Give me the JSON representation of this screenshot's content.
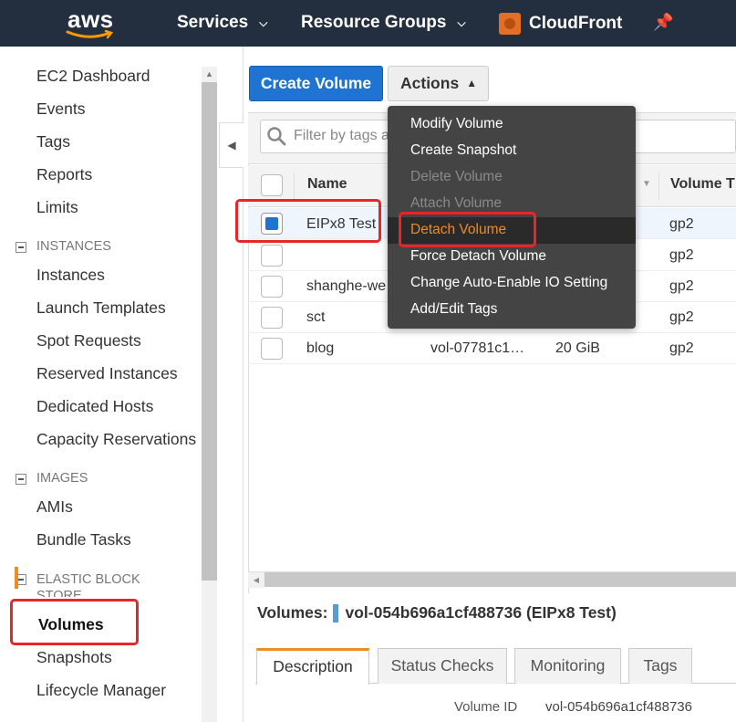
{
  "topnav": {
    "logo": "aws",
    "services": "Services",
    "resource_groups": "Resource Groups",
    "cloudfront": "CloudFront",
    "pin_icon": "pin-icon"
  },
  "sidebar": {
    "links_top": [
      "EC2 Dashboard",
      "Events",
      "Tags",
      "Reports",
      "Limits"
    ],
    "instances_header": "INSTANCES",
    "instances_links": [
      "Instances",
      "Launch Templates",
      "Spot Requests",
      "Reserved Instances",
      "Dedicated Hosts",
      "Capacity Reservations"
    ],
    "images_header": "IMAGES",
    "images_links": [
      "AMIs",
      "Bundle Tasks"
    ],
    "ebs_header_1": "ELASTIC BLOCK",
    "ebs_header_2": "STORE",
    "ebs_links": [
      "Volumes",
      "Snapshots",
      "Lifecycle Manager"
    ]
  },
  "toolbar": {
    "create_volume": "Create Volume",
    "actions": "Actions"
  },
  "filter": {
    "placeholder": "Filter by tags a"
  },
  "table": {
    "headers": {
      "name": "Name",
      "volume_type": "Volume T"
    },
    "rows": [
      {
        "name": "EIPx8 Test",
        "volume_id": "",
        "size": "",
        "type": "gp2",
        "selected": true
      },
      {
        "name": "",
        "volume_id": "",
        "size": "",
        "type": "gp2",
        "selected": false
      },
      {
        "name": "shanghe-we",
        "volume_id": "",
        "size": "",
        "type": "gp2",
        "selected": false
      },
      {
        "name": "sct",
        "volume_id": "",
        "size": "",
        "type": "gp2",
        "selected": false
      },
      {
        "name": "blog",
        "volume_id": "vol-07781c1…",
        "size": "20 GiB",
        "type": "gp2",
        "selected": false
      }
    ]
  },
  "actions_menu": {
    "items": [
      {
        "label": "Modify Volume",
        "disabled": false
      },
      {
        "label": "Create Snapshot",
        "disabled": false
      },
      {
        "label": "Delete Volume",
        "disabled": true
      },
      {
        "label": "Attach Volume",
        "disabled": true
      },
      {
        "label": "Detach Volume",
        "disabled": false,
        "highlighted": true
      },
      {
        "label": "Force Detach Volume",
        "disabled": false
      },
      {
        "label": "Change Auto-Enable IO Setting",
        "disabled": false
      },
      {
        "label": "Add/Edit Tags",
        "disabled": false
      }
    ]
  },
  "detail": {
    "prefix": "Volumes:",
    "title": "vol-054b696a1cf488736 (EIPx8 Test)",
    "tabs": [
      "Description",
      "Status Checks",
      "Monitoring",
      "Tags"
    ],
    "volume_id_label": "Volume ID",
    "volume_id_value": "vol-054b696a1cf488736"
  },
  "colors": {
    "nav_bg": "#232f3e",
    "primary_button": "#1f74d1",
    "accent_orange": "#f08a24",
    "annotation_red": "#e8262a"
  }
}
